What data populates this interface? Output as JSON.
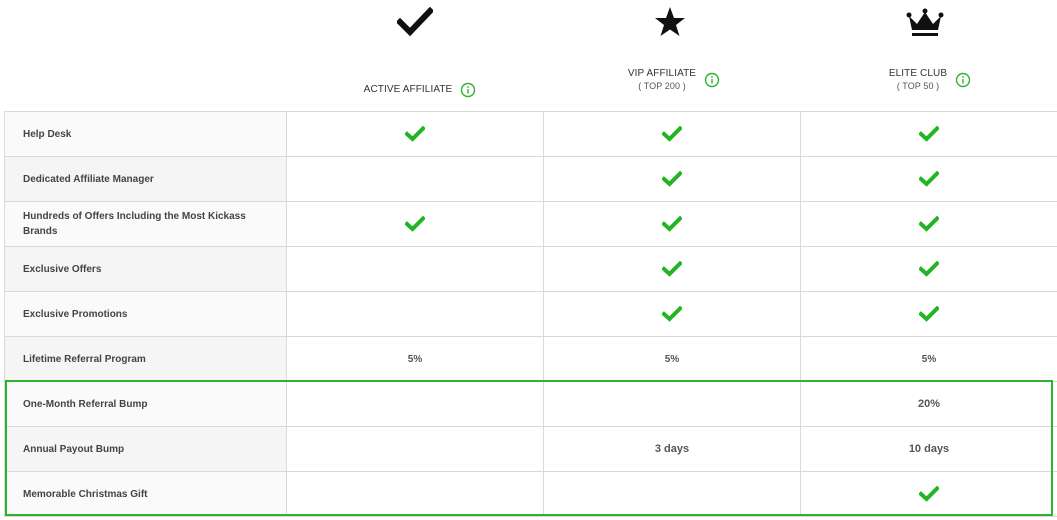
{
  "tiers": [
    {
      "icon": "checkmark-icon",
      "name": "ACTIVE AFFILIATE",
      "sub": ""
    },
    {
      "icon": "star-icon",
      "name": "VIP AFFILIATE",
      "sub": "( TOP 200 )"
    },
    {
      "icon": "crown-icon",
      "name": "ELITE CLUB",
      "sub": "( TOP 50 )"
    }
  ],
  "info_icon": "info-icon",
  "features": [
    {
      "label": "Help Desk",
      "cells": [
        "check",
        "check",
        "check"
      ]
    },
    {
      "label": "Dedicated Affiliate Manager",
      "cells": [
        "",
        "check",
        "check"
      ]
    },
    {
      "label": "Hundreds of Offers Including the Most Kickass Brands",
      "cells": [
        "check",
        "check",
        "check"
      ]
    },
    {
      "label": "Exclusive Offers",
      "cells": [
        "",
        "check",
        "check"
      ]
    },
    {
      "label": "Exclusive Promotions",
      "cells": [
        "",
        "check",
        "check"
      ]
    },
    {
      "label": "Lifetime Referral Program",
      "cells": [
        "5%",
        "5%",
        "5%"
      ]
    },
    {
      "label": "One-Month Referral Bump",
      "cells": [
        "",
        "",
        "20%"
      ]
    },
    {
      "label": "Annual Payout Bump",
      "cells": [
        "",
        "3 days",
        "10 days"
      ]
    },
    {
      "label": "Memorable Christmas Gift",
      "cells": [
        "",
        "",
        "check"
      ]
    }
  ],
  "colors": {
    "check_green": "#22b422",
    "highlight_border": "#2db32d",
    "info_green": "#2db32d"
  }
}
